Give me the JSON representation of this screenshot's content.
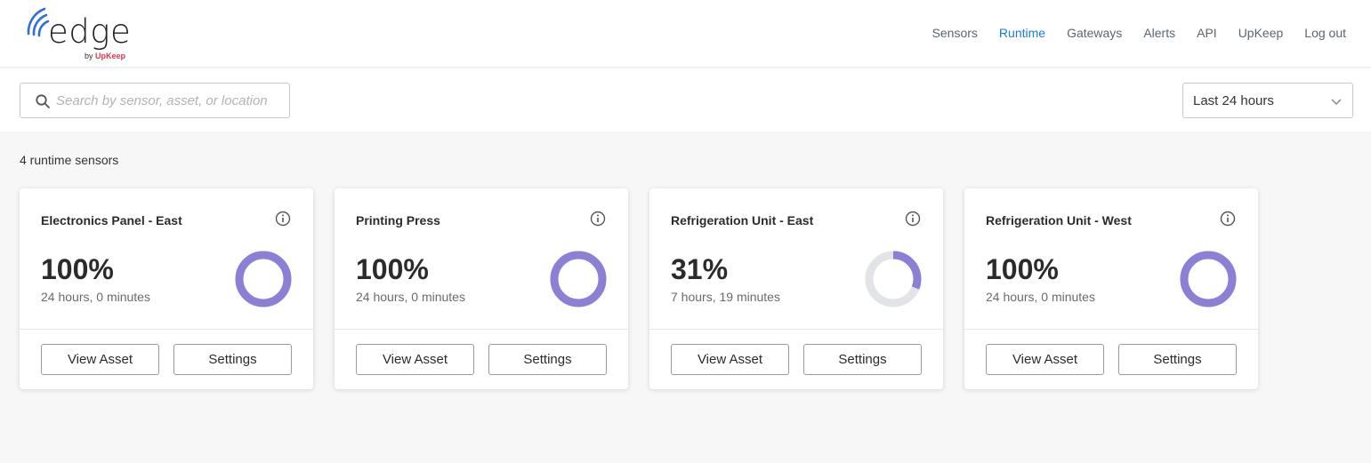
{
  "brand": {
    "logo_word": "edge",
    "by_text": "by",
    "by_brand": "UpKeep",
    "accent": "#2f6fd6",
    "brand_red": "#e8374b"
  },
  "nav": {
    "items": [
      {
        "label": "Sensors",
        "active": false
      },
      {
        "label": "Runtime",
        "active": true
      },
      {
        "label": "Gateways",
        "active": false
      },
      {
        "label": "Alerts",
        "active": false
      },
      {
        "label": "API",
        "active": false
      },
      {
        "label": "UpKeep",
        "active": false
      },
      {
        "label": "Log out",
        "active": false
      }
    ],
    "active_color": "#1b7cd6"
  },
  "search": {
    "placeholder": "Search by sensor, asset, or location",
    "value": "",
    "icon": "search-icon"
  },
  "time_range": {
    "selected": "Last 24 hours",
    "icon": "chevron-down-icon"
  },
  "summary": {
    "count_text": "4 runtime sensors"
  },
  "colors": {
    "donut_fill": "#8b7fd6",
    "donut_track": "#e3e4e8"
  },
  "cards": [
    {
      "title": "Electronics Panel - East",
      "percent_text": "100%",
      "duration": "24 hours, 0 minutes",
      "runtime_fraction": 1.0,
      "view_label": "View Asset",
      "settings_label": "Settings"
    },
    {
      "title": "Printing Press",
      "percent_text": "100%",
      "duration": "24 hours, 0 minutes",
      "runtime_fraction": 1.0,
      "view_label": "View Asset",
      "settings_label": "Settings"
    },
    {
      "title": "Refrigeration Unit - East",
      "percent_text": "31%",
      "duration": "7 hours, 19 minutes",
      "runtime_fraction": 0.31,
      "view_label": "View Asset",
      "settings_label": "Settings"
    },
    {
      "title": "Refrigeration Unit - West",
      "percent_text": "100%",
      "duration": "24 hours, 0 minutes",
      "runtime_fraction": 1.0,
      "view_label": "View Asset",
      "settings_label": "Settings"
    }
  ]
}
